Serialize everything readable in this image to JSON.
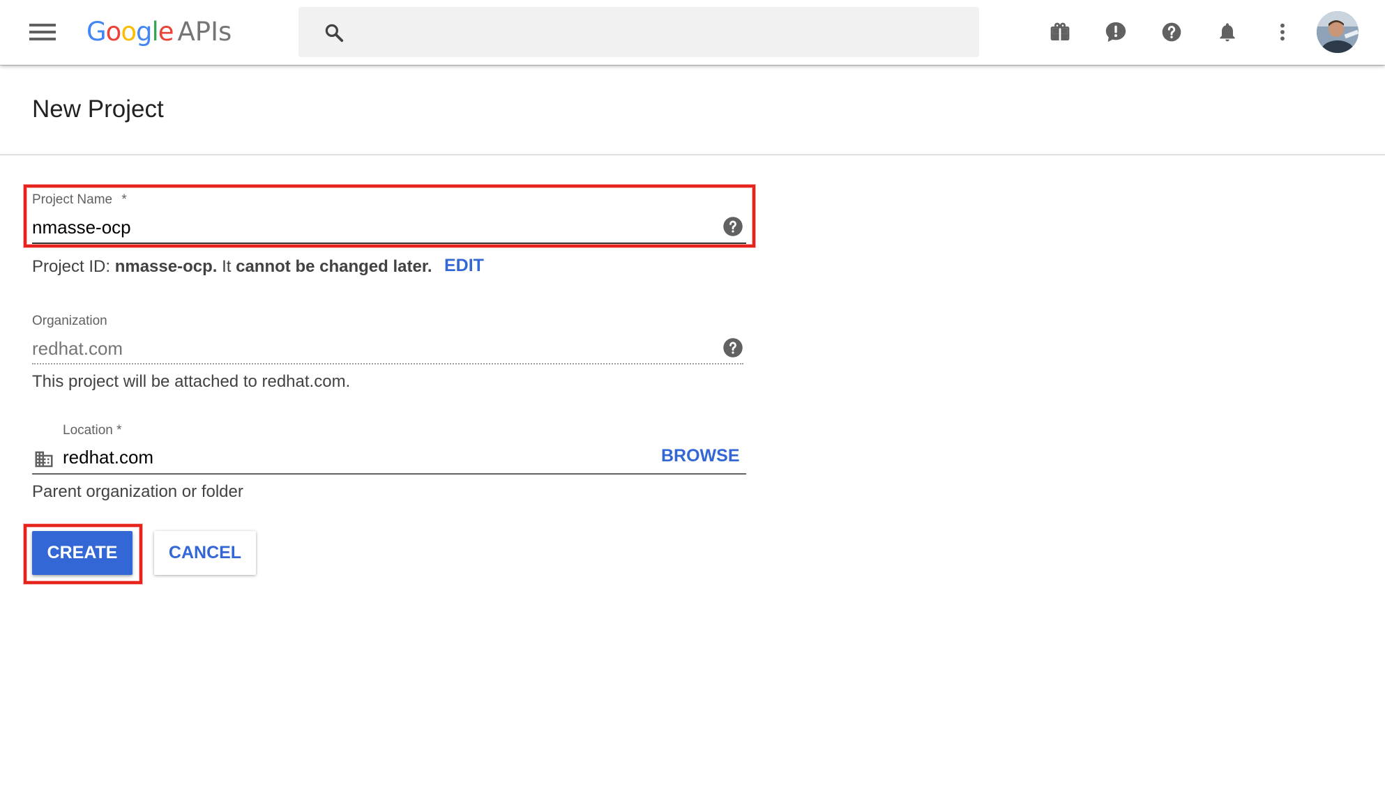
{
  "header": {
    "logo": {
      "google_letters": [
        "G",
        "o",
        "o",
        "g",
        "l",
        "e"
      ],
      "suffix": "APIs"
    },
    "search": {
      "value": "",
      "placeholder": ""
    },
    "icons": [
      "menu-icon",
      "gift-icon",
      "feedback-icon",
      "help-icon",
      "notifications-icon",
      "more-vert-icon"
    ],
    "avatar_alt": "Account"
  },
  "page": {
    "title": "New Project"
  },
  "form": {
    "project_name": {
      "label": "Project Name",
      "required_mark": "*",
      "value": "nmasse-ocp"
    },
    "project_id": {
      "prefix": "Project ID:",
      "id": "nmasse-ocp.",
      "middle": "It",
      "suffix": "cannot be changed later.",
      "edit_label": "EDIT"
    },
    "organization": {
      "label": "Organization",
      "value": "redhat.com",
      "hint": "This project will be attached to redhat.com."
    },
    "location": {
      "label": "Location *",
      "value": "redhat.com",
      "browse_label": "BROWSE",
      "hint": "Parent organization or folder"
    }
  },
  "actions": {
    "create_label": "CREATE",
    "cancel_label": "CANCEL"
  },
  "colors": {
    "accent": "#3367d6",
    "annotation": "#e6231c",
    "google_blue": "#4285f4",
    "google_red": "#ea4335",
    "google_yellow": "#fbbc05",
    "google_green": "#34a853"
  }
}
